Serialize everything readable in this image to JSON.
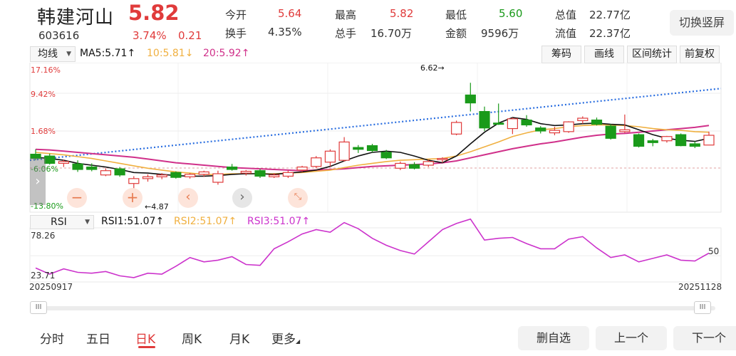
{
  "stock": {
    "name": "韩建河山",
    "price": "5.82",
    "code": "603616",
    "change_pct": "3.74%",
    "change": "0.21"
  },
  "stats": {
    "open_label": "今开",
    "open": "5.64",
    "high_label": "最高",
    "high": "5.82",
    "low_label": "最低",
    "low": "5.60",
    "total_value_label": "总值",
    "total_value": "22.77亿",
    "turnover_label": "换手",
    "turnover": "4.35%",
    "total_hands_label": "总手",
    "total_hands": "16.70万",
    "amount_label": "金额",
    "amount": "9596万",
    "float_value_label": "流值",
    "float_value": "22.37亿"
  },
  "header": {
    "switch_label": "切换竖屏"
  },
  "toolbar": {
    "ma_select": "均线",
    "ma5": "MA5:5.71↑",
    "ma10": "10:5.81↓",
    "ma20": "20:5.92↑",
    "chip_label": "筹码",
    "draw_label": "画线",
    "range_label": "区间统计",
    "adjust_label": "前复权"
  },
  "main_chart": {
    "y_labels": [
      "17.16%",
      "9.42%",
      "1.68%",
      "-6.06%",
      "-13.80%"
    ],
    "max_label": "6.62→",
    "min_label": "←4.87"
  },
  "rsi": {
    "select": "RSI",
    "rsi1": "RSI1:51.07↑",
    "rsi2": "RSI2:51.07↑",
    "rsi3": "RSI3:51.07↑",
    "y_top": "78.26",
    "y_bottom": "23.71",
    "y_mid": "50"
  },
  "dates": {
    "start": "20250917",
    "end": "20251128"
  },
  "tabs": [
    "分时",
    "五日",
    "日K",
    "周K",
    "月K",
    "更多"
  ],
  "bottom": {
    "delete_fav": "删自选",
    "prev": "上一个",
    "next": "下一个"
  },
  "colors": {
    "up": "#e03b3b",
    "down": "#1a9a1a",
    "ma5": "#111111",
    "ma10": "#f0b040",
    "ma20": "#d0308a",
    "rsi": "#cc33cc",
    "trend": "#2a6ee0"
  },
  "chart_data": {
    "type": "candlestick",
    "x": [
      "20250917",
      "20251128"
    ],
    "ylim": [
      4.5,
      6.95
    ],
    "candles": [
      {
        "o": 5.45,
        "h": 5.53,
        "l": 5.35,
        "c": 5.38
      },
      {
        "o": 5.42,
        "h": 5.46,
        "l": 5.28,
        "c": 5.3
      },
      {
        "o": 5.3,
        "h": 5.36,
        "l": 5.24,
        "c": 5.33
      },
      {
        "o": 5.29,
        "h": 5.35,
        "l": 5.16,
        "c": 5.2
      },
      {
        "o": 5.24,
        "h": 5.3,
        "l": 5.17,
        "c": 5.2
      },
      {
        "o": 5.11,
        "h": 5.22,
        "l": 5.09,
        "c": 5.18
      },
      {
        "o": 5.21,
        "h": 5.24,
        "l": 5.08,
        "c": 5.11
      },
      {
        "o": 4.97,
        "h": 5.09,
        "l": 4.87,
        "c": 5.05
      },
      {
        "o": 5.05,
        "h": 5.12,
        "l": 5.0,
        "c": 5.08
      },
      {
        "o": 5.08,
        "h": 5.14,
        "l": 5.04,
        "c": 5.11
      },
      {
        "o": 5.15,
        "h": 5.17,
        "l": 5.05,
        "c": 5.07
      },
      {
        "o": 5.08,
        "h": 5.14,
        "l": 5.05,
        "c": 5.12
      },
      {
        "o": 5.12,
        "h": 5.18,
        "l": 5.08,
        "c": 5.16
      },
      {
        "o": 4.99,
        "h": 5.18,
        "l": 4.95,
        "c": 5.13
      },
      {
        "o": 5.24,
        "h": 5.29,
        "l": 5.18,
        "c": 5.2
      },
      {
        "o": 5.14,
        "h": 5.19,
        "l": 5.1,
        "c": 5.17
      },
      {
        "o": 5.18,
        "h": 5.21,
        "l": 5.06,
        "c": 5.09
      },
      {
        "o": 5.08,
        "h": 5.14,
        "l": 5.06,
        "c": 5.11
      },
      {
        "o": 5.09,
        "h": 5.18,
        "l": 5.06,
        "c": 5.15
      },
      {
        "o": 5.19,
        "h": 5.26,
        "l": 5.16,
        "c": 5.24
      },
      {
        "o": 5.25,
        "h": 5.42,
        "l": 5.22,
        "c": 5.39
      },
      {
        "o": 5.32,
        "h": 5.53,
        "l": 5.25,
        "c": 5.5
      },
      {
        "o": 5.35,
        "h": 5.73,
        "l": 5.33,
        "c": 5.65
      },
      {
        "o": 5.56,
        "h": 5.6,
        "l": 5.47,
        "c": 5.53
      },
      {
        "o": 5.59,
        "h": 5.62,
        "l": 5.48,
        "c": 5.51
      },
      {
        "o": 5.48,
        "h": 5.52,
        "l": 5.37,
        "c": 5.39
      },
      {
        "o": 5.22,
        "h": 5.33,
        "l": 5.19,
        "c": 5.3
      },
      {
        "o": 5.28,
        "h": 5.32,
        "l": 5.2,
        "c": 5.22
      },
      {
        "o": 5.27,
        "h": 5.36,
        "l": 5.24,
        "c": 5.33
      },
      {
        "o": 5.36,
        "h": 5.4,
        "l": 5.31,
        "c": 5.38
      },
      {
        "o": 5.78,
        "h": 6.0,
        "l": 5.76,
        "c": 5.97
      },
      {
        "o": 6.42,
        "h": 6.62,
        "l": 6.15,
        "c": 6.29
      },
      {
        "o": 6.15,
        "h": 6.23,
        "l": 5.83,
        "c": 5.88
      },
      {
        "o": 5.96,
        "h": 6.28,
        "l": 5.93,
        "c": 5.94
      },
      {
        "o": 5.87,
        "h": 6.05,
        "l": 5.78,
        "c": 6.03
      },
      {
        "o": 6.01,
        "h": 6.09,
        "l": 5.9,
        "c": 5.93
      },
      {
        "o": 5.88,
        "h": 5.91,
        "l": 5.79,
        "c": 5.83
      },
      {
        "o": 5.8,
        "h": 5.9,
        "l": 5.76,
        "c": 5.84
      },
      {
        "o": 5.82,
        "h": 5.99,
        "l": 5.8,
        "c": 5.98
      },
      {
        "o": 6.0,
        "h": 6.07,
        "l": 5.95,
        "c": 6.04
      },
      {
        "o": 6.01,
        "h": 6.05,
        "l": 5.92,
        "c": 5.94
      },
      {
        "o": 5.91,
        "h": 5.94,
        "l": 5.69,
        "c": 5.71
      },
      {
        "o": 5.82,
        "h": 6.1,
        "l": 5.8,
        "c": 5.85
      },
      {
        "o": 5.77,
        "h": 5.79,
        "l": 5.56,
        "c": 5.58
      },
      {
        "o": 5.67,
        "h": 5.7,
        "l": 5.58,
        "c": 5.64
      },
      {
        "o": 5.67,
        "h": 5.75,
        "l": 5.64,
        "c": 5.74
      },
      {
        "o": 5.77,
        "h": 5.79,
        "l": 5.58,
        "c": 5.59
      },
      {
        "o": 5.62,
        "h": 5.66,
        "l": 5.55,
        "c": 5.58
      },
      {
        "o": 5.6,
        "h": 5.82,
        "l": 5.6,
        "c": 5.76
      }
    ],
    "ma5": [
      5.4,
      5.38,
      5.35,
      5.3,
      5.27,
      5.24,
      5.2,
      5.15,
      5.14,
      5.12,
      5.1,
      5.09,
      5.09,
      5.1,
      5.12,
      5.13,
      5.13,
      5.12,
      5.14,
      5.16,
      5.19,
      5.25,
      5.34,
      5.42,
      5.48,
      5.5,
      5.48,
      5.42,
      5.35,
      5.31,
      5.42,
      5.62,
      5.81,
      5.96,
      6.05,
      6.02,
      5.95,
      5.92,
      5.93,
      5.95,
      5.96,
      5.94,
      5.93,
      5.85,
      5.77,
      5.71,
      5.68,
      5.66,
      5.71
    ],
    "ma10": [
      5.48,
      5.46,
      5.44,
      5.41,
      5.38,
      5.34,
      5.3,
      5.26,
      5.22,
      5.19,
      5.16,
      5.14,
      5.12,
      5.12,
      5.13,
      5.13,
      5.13,
      5.13,
      5.14,
      5.15,
      5.17,
      5.19,
      5.23,
      5.27,
      5.3,
      5.33,
      5.35,
      5.36,
      5.37,
      5.38,
      5.42,
      5.49,
      5.57,
      5.65,
      5.74,
      5.8,
      5.85,
      5.87,
      5.9,
      5.92,
      5.93,
      5.93,
      5.92,
      5.9,
      5.87,
      5.85,
      5.84,
      5.82,
      5.81
    ],
    "ma20": [
      5.53,
      5.52,
      5.5,
      5.48,
      5.46,
      5.44,
      5.42,
      5.4,
      5.37,
      5.34,
      5.31,
      5.29,
      5.27,
      5.25,
      5.23,
      5.22,
      5.21,
      5.2,
      5.19,
      5.18,
      5.19,
      5.2,
      5.21,
      5.23,
      5.25,
      5.26,
      5.27,
      5.28,
      5.29,
      5.31,
      5.34,
      5.39,
      5.44,
      5.49,
      5.54,
      5.58,
      5.62,
      5.65,
      5.69,
      5.73,
      5.76,
      5.78,
      5.79,
      5.81,
      5.83,
      5.85,
      5.87,
      5.89,
      5.92
    ],
    "trendline": {
      "x0": 0,
      "y0": 5.35,
      "x1": 48,
      "y1": 6.48
    },
    "rsi": [
      36,
      29,
      35,
      31,
      30,
      32,
      27,
      25,
      30,
      29,
      38,
      48,
      43,
      45,
      49,
      40,
      39,
      58,
      66,
      75,
      80,
      77,
      88,
      81,
      70,
      62,
      56,
      52,
      66,
      80,
      87,
      92,
      68,
      70,
      71,
      64,
      58,
      58,
      69,
      72,
      59,
      48,
      51,
      43,
      47,
      51,
      45,
      44,
      53
    ],
    "rsi_ylim": [
      20,
      82
    ]
  }
}
